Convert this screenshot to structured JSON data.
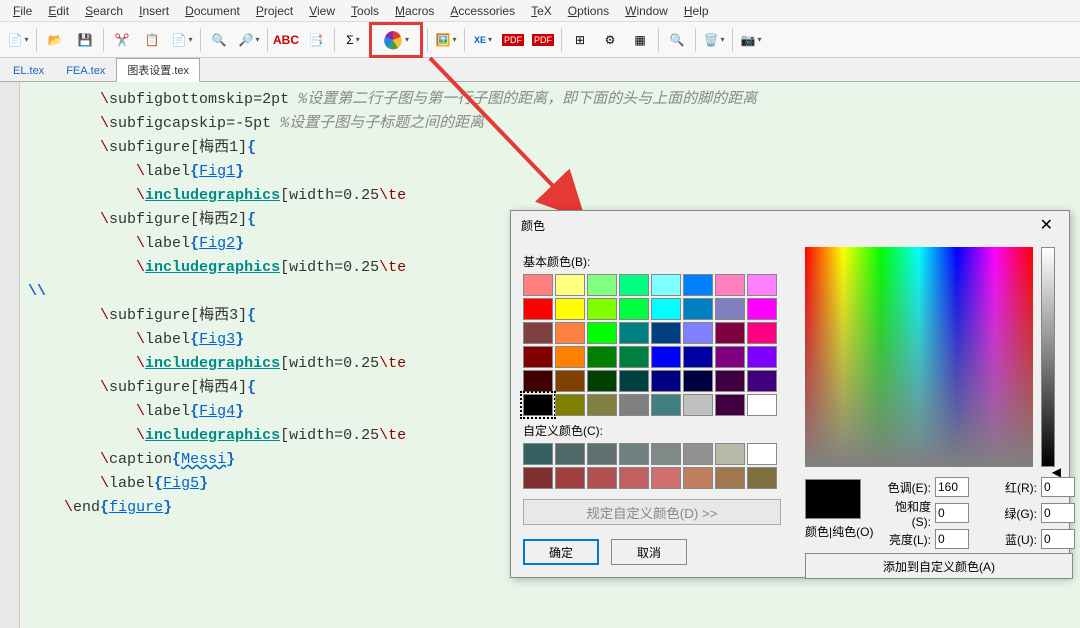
{
  "menu": [
    "File",
    "Edit",
    "Search",
    "Insert",
    "Document",
    "Project",
    "View",
    "Tools",
    "Macros",
    "Accessories",
    "TeX",
    "Options",
    "Window",
    "Help"
  ],
  "tabs": [
    {
      "label": "EL.tex",
      "active": false
    },
    {
      "label": "FEA.tex",
      "active": false
    },
    {
      "label": "图表设置.tex",
      "active": true
    }
  ],
  "code": [
    {
      "indent": 2,
      "parts": [
        {
          "t": "\\",
          "c": "kw-bs"
        },
        {
          "t": "subfigbottomskip",
          "c": ""
        },
        {
          "t": "=2pt ",
          "c": ""
        },
        {
          "t": "%设置第二行子图与第一行子图的距离，即下面的头与上面的脚的距离",
          "c": "kw-cmt"
        }
      ]
    },
    {
      "indent": 2,
      "parts": [
        {
          "t": "\\",
          "c": "kw-bs"
        },
        {
          "t": "subfigcapskip",
          "c": ""
        },
        {
          "t": "=-5pt ",
          "c": ""
        },
        {
          "t": "%设置子图与子标题之间的距离",
          "c": "kw-cmt"
        }
      ]
    },
    {
      "indent": 2,
      "parts": [
        {
          "t": "\\",
          "c": "kw-bs"
        },
        {
          "t": "subfigure",
          "c": ""
        },
        {
          "t": "[",
          "c": "kw-brk"
        },
        {
          "t": "梅西1",
          "c": ""
        },
        {
          "t": "]",
          "c": "kw-brk"
        },
        {
          "t": "{",
          "c": "kw-brc"
        }
      ]
    },
    {
      "indent": 3,
      "parts": [
        {
          "t": "\\",
          "c": "kw-bs"
        },
        {
          "t": "label",
          "c": ""
        },
        {
          "t": "{",
          "c": "kw-brc"
        },
        {
          "t": "Fig1",
          "c": "kw-ref"
        },
        {
          "t": "}",
          "c": "kw-brc"
        }
      ]
    },
    {
      "indent": 3,
      "parts": [
        {
          "t": "\\",
          "c": "kw-bs"
        },
        {
          "t": "includegraphics",
          "c": "kw-cmd"
        },
        {
          "t": "[",
          "c": "kw-brk"
        },
        {
          "t": "width=0.25",
          "c": ""
        },
        {
          "t": "\\te",
          "c": "kw-bs"
        }
      ]
    },
    {
      "indent": 2,
      "parts": [
        {
          "t": "\\",
          "c": "kw-bs"
        },
        {
          "t": "subfigure",
          "c": ""
        },
        {
          "t": "[",
          "c": "kw-brk"
        },
        {
          "t": "梅西2",
          "c": ""
        },
        {
          "t": "]",
          "c": "kw-brk"
        },
        {
          "t": "{",
          "c": "kw-brc"
        }
      ]
    },
    {
      "indent": 3,
      "parts": [
        {
          "t": "\\",
          "c": "kw-bs"
        },
        {
          "t": "label",
          "c": ""
        },
        {
          "t": "{",
          "c": "kw-brc"
        },
        {
          "t": "Fig2",
          "c": "kw-ref"
        },
        {
          "t": "}",
          "c": "kw-brc"
        }
      ]
    },
    {
      "indent": 3,
      "parts": [
        {
          "t": "\\",
          "c": "kw-bs"
        },
        {
          "t": "includegraphics",
          "c": "kw-cmd"
        },
        {
          "t": "[",
          "c": "kw-brk"
        },
        {
          "t": "width=0.25",
          "c": ""
        },
        {
          "t": "\\te",
          "c": "kw-bs"
        }
      ]
    },
    {
      "indent": 0,
      "parts": [
        {
          "t": "\\\\",
          "c": "kw-dbs"
        }
      ]
    },
    {
      "indent": 2,
      "parts": [
        {
          "t": "\\",
          "c": "kw-bs"
        },
        {
          "t": "subfigure",
          "c": ""
        },
        {
          "t": "[",
          "c": "kw-brk"
        },
        {
          "t": "梅西3",
          "c": ""
        },
        {
          "t": "]",
          "c": "kw-brk"
        },
        {
          "t": "{",
          "c": "kw-brc"
        }
      ]
    },
    {
      "indent": 3,
      "parts": [
        {
          "t": "\\",
          "c": "kw-bs"
        },
        {
          "t": "label",
          "c": ""
        },
        {
          "t": "{",
          "c": "kw-brc"
        },
        {
          "t": "Fig3",
          "c": "kw-ref"
        },
        {
          "t": "}",
          "c": "kw-brc"
        }
      ]
    },
    {
      "indent": 3,
      "parts": [
        {
          "t": "\\",
          "c": "kw-bs"
        },
        {
          "t": "includegraphics",
          "c": "kw-cmd"
        },
        {
          "t": "[",
          "c": "kw-brk"
        },
        {
          "t": "width=0.25",
          "c": ""
        },
        {
          "t": "\\te",
          "c": "kw-bs"
        }
      ]
    },
    {
      "indent": 2,
      "parts": [
        {
          "t": "\\",
          "c": "kw-bs"
        },
        {
          "t": "subfigure",
          "c": ""
        },
        {
          "t": "[",
          "c": "kw-brk"
        },
        {
          "t": "梅西4",
          "c": ""
        },
        {
          "t": "]",
          "c": "kw-brk"
        },
        {
          "t": "{",
          "c": "kw-brc"
        }
      ]
    },
    {
      "indent": 3,
      "parts": [
        {
          "t": "\\",
          "c": "kw-bs"
        },
        {
          "t": "label",
          "c": ""
        },
        {
          "t": "{",
          "c": "kw-brc"
        },
        {
          "t": "Fig4",
          "c": "kw-ref"
        },
        {
          "t": "}",
          "c": "kw-brc"
        }
      ]
    },
    {
      "indent": 3,
      "parts": [
        {
          "t": "\\",
          "c": "kw-bs"
        },
        {
          "t": "includegraphics",
          "c": "kw-cmd"
        },
        {
          "t": "[",
          "c": "kw-brk"
        },
        {
          "t": "width=0.25",
          "c": ""
        },
        {
          "t": "\\te",
          "c": "kw-bs"
        }
      ]
    },
    {
      "indent": 2,
      "parts": [
        {
          "t": "\\",
          "c": "kw-bs"
        },
        {
          "t": "caption",
          "c": ""
        },
        {
          "t": "{",
          "c": "kw-brc"
        },
        {
          "t": "Messi",
          "c": "kw-refu"
        },
        {
          "t": "}",
          "c": "kw-brc"
        }
      ]
    },
    {
      "indent": 2,
      "parts": [
        {
          "t": "\\",
          "c": "kw-bs"
        },
        {
          "t": "label",
          "c": ""
        },
        {
          "t": "{",
          "c": "kw-brc"
        },
        {
          "t": "Fig5",
          "c": "kw-ref"
        },
        {
          "t": "}",
          "c": "kw-brc"
        }
      ]
    },
    {
      "indent": 1,
      "parts": [
        {
          "t": "\\",
          "c": "kw-bs"
        },
        {
          "t": "end",
          "c": ""
        },
        {
          "t": "{",
          "c": "kw-brc"
        },
        {
          "t": "figure",
          "c": "kw-ref"
        },
        {
          "t": "}",
          "c": "kw-brc"
        }
      ]
    }
  ],
  "dialog": {
    "title": "颜色",
    "basic_label": "基本颜色(B):",
    "basic_colors": [
      "#ff8080",
      "#ffff80",
      "#80ff80",
      "#00ff80",
      "#80ffff",
      "#0080ff",
      "#ff80c0",
      "#ff80ff",
      "#ff0000",
      "#ffff00",
      "#80ff00",
      "#00ff40",
      "#00ffff",
      "#0080c0",
      "#8080c0",
      "#ff00ff",
      "#804040",
      "#ff8040",
      "#00ff00",
      "#008080",
      "#004080",
      "#8080ff",
      "#800040",
      "#ff0080",
      "#800000",
      "#ff8000",
      "#008000",
      "#008040",
      "#0000ff",
      "#0000a0",
      "#800080",
      "#8000ff",
      "#400000",
      "#804000",
      "#004000",
      "#004040",
      "#000080",
      "#000040",
      "#400040",
      "#400080",
      "#000000",
      "#808000",
      "#808040",
      "#808080",
      "#408080",
      "#c0c0c0",
      "#400040",
      "#ffffff"
    ],
    "selected_basic": 40,
    "custom_label": "自定义颜色(C):",
    "custom_colors": [
      "#356060",
      "#506868",
      "#607070",
      "#708080",
      "#808888",
      "#909090",
      "#b8b8a8",
      "#ffffff",
      "#803030",
      "#a04040",
      "#b05050",
      "#c06060",
      "#d07070",
      "#c08060",
      "#a07850",
      "#807040"
    ],
    "define_btn": "规定自定义颜色(D) >>",
    "ok_btn": "确定",
    "cancel_btn": "取消",
    "preview_label": "颜色|纯色(O)",
    "fields": {
      "hue_l": "色调(E):",
      "hue_v": "160",
      "sat_l": "饱和度(S):",
      "sat_v": "0",
      "lum_l": "亮度(L):",
      "lum_v": "0",
      "r_l": "红(R):",
      "r_v": "0",
      "g_l": "绿(G):",
      "g_v": "0",
      "b_l": "蓝(U):",
      "b_v": "0"
    },
    "add_btn": "添加到自定义颜色(A)"
  }
}
